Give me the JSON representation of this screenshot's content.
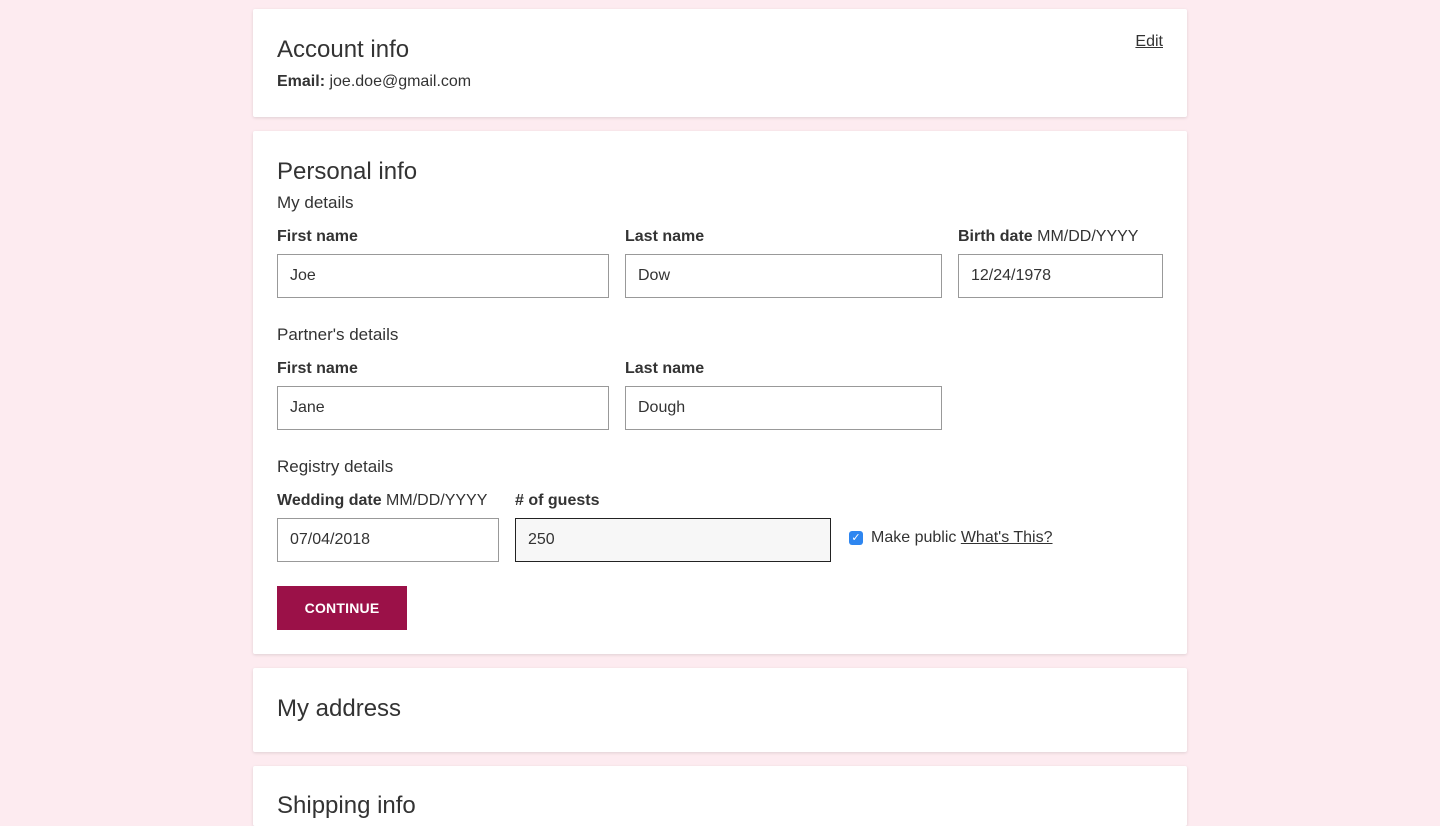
{
  "account": {
    "title": "Account info",
    "edit_label": "Edit",
    "email_label": "Email:",
    "email_value": "joe.doe@gmail.com"
  },
  "personal": {
    "title": "Personal info",
    "my_details": {
      "section_label": "My details",
      "first_name_label": "First name",
      "first_name_value": "Joe",
      "last_name_label": "Last name",
      "last_name_value": "Dow",
      "birth_date_label": "Birth date",
      "birth_date_hint": "MM/DD/YYYY",
      "birth_date_value": "12/24/1978"
    },
    "partner_details": {
      "section_label": "Partner's details",
      "first_name_label": "First name",
      "first_name_value": "Jane",
      "last_name_label": "Last name",
      "last_name_value": "Dough"
    },
    "registry_details": {
      "section_label": "Registry details",
      "wedding_date_label": "Wedding date",
      "wedding_date_hint": "MM/DD/YYYY",
      "wedding_date_value": "07/04/2018",
      "guests_label": "# of guests",
      "guests_value": "250",
      "make_public_label": "Make public",
      "make_public_checked": true,
      "whats_this_label": "What's This?"
    },
    "continue_label": "CONTINUE"
  },
  "address": {
    "title": "My address"
  },
  "shipping": {
    "title": "Shipping info"
  },
  "colors": {
    "background": "#fdebf0",
    "accent": "#9b1148",
    "checkbox": "#2e86f0"
  }
}
